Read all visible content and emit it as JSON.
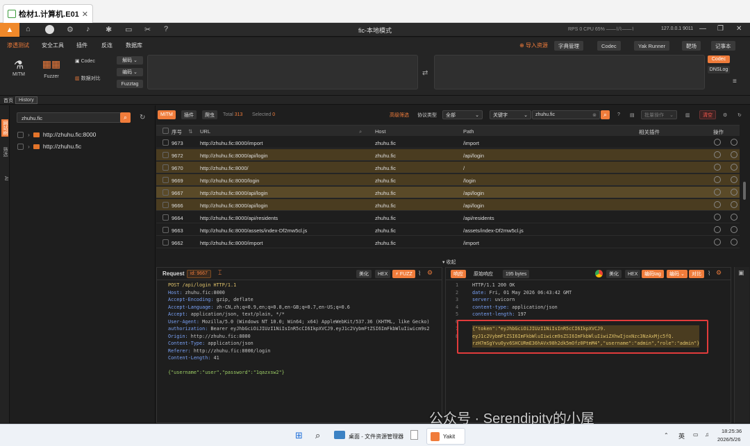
{
  "vm_tab": {
    "title": "检材1.计算机.E01",
    "close": "✕"
  },
  "app": {
    "title": "fic-本地模式",
    "stats": "RPS 0 CPU 65% ——⌇/⌇——⌇",
    "ip": "127.0.0.1  9011"
  },
  "menu": {
    "items": [
      "渗透测试",
      "安全工具",
      "插件",
      "反连",
      "数据库"
    ],
    "right": [
      "导入资源",
      "字典管理",
      "Codec",
      "Yak Runner",
      "靶场",
      "记事本"
    ]
  },
  "toolbar": {
    "mitm": "MITM",
    "fuzzer": "Fuzzer",
    "codec": "Codec",
    "compare": "数据对比",
    "decode": "解码",
    "encode": "编码",
    "fuzztag": "Fuzztag",
    "right_codec": "Codec",
    "right_dnslog": "DNSLog"
  },
  "tabs2": [
    "首页",
    "History"
  ],
  "leftvert": [
    "网站树",
    "筛选",
    "AI"
  ],
  "sidebar": {
    "search": "zhuhu.fic",
    "tree": [
      "http://zhuhu.fic:8000",
      "http://zhuhu.fic"
    ]
  },
  "filter": {
    "mitm": "MITM",
    "plugin": "插件",
    "crawler": "爬虫",
    "total_label": "Total",
    "total": "313",
    "selected_label": "Selected",
    "selected": "0",
    "advanced": "高级筛选",
    "protocol_label": "协议类型",
    "protocol": "全部",
    "keyword": "关键字",
    "keyword_value": "zhuhu.fic",
    "batch": "批量操作",
    "clear": "清空"
  },
  "table": {
    "headers": [
      "序号",
      "URL",
      "Host",
      "Path",
      "相关插件",
      "操作"
    ],
    "rows": [
      {
        "id": "9673",
        "url": "http://zhuhu.fic:8000/import",
        "host": "zhuhu.fic",
        "path": "/import",
        "color": ""
      },
      {
        "id": "9672",
        "url": "http://zhuhu.fic:8000/api/login",
        "host": "zhuhu.fic",
        "path": "/api/login",
        "color": "#4a3c20"
      },
      {
        "id": "9670",
        "url": "http://zhuhu.fic:8000/",
        "host": "zhuhu.fic",
        "path": "/",
        "color": "#4a3c20"
      },
      {
        "id": "9669",
        "url": "http://zhuhu.fic:8000/login",
        "host": "zhuhu.fic",
        "path": "/login",
        "color": "#4a3c20"
      },
      {
        "id": "9667",
        "url": "http://zhuhu.fic:8000/api/login",
        "host": "zhuhu.fic",
        "path": "/api/login",
        "color": "#5a4a28"
      },
      {
        "id": "9666",
        "url": "http://zhuhu.fic:8000/api/login",
        "host": "zhuhu.fic",
        "path": "/api/login",
        "color": "#4a3c20"
      },
      {
        "id": "9664",
        "url": "http://zhuhu.fic:8000/api/residents",
        "host": "zhuhu.fic",
        "path": "/api/residents",
        "color": ""
      },
      {
        "id": "9663",
        "url": "http://zhuhu.fic:8000/assets/index-Df2mw5cl.js",
        "host": "zhuhu.fic",
        "path": "/assets/index-Df2mw5cl.js",
        "color": ""
      },
      {
        "id": "9662",
        "url": "http://zhuhu.fic:8000/import",
        "host": "zhuhu.fic",
        "path": "/import",
        "color": ""
      }
    ]
  },
  "collapse": "收起",
  "request": {
    "title": "Request",
    "id_label": "id: 9667",
    "beautify": "美化",
    "hex": "HEX",
    "fuzz": "FUZZ",
    "lines": [
      "POST /api/login HTTP/1.1",
      "Host: zhuhu.fic:8000",
      "Accept-Encoding: gzip, deflate",
      "Accept-Language: zh-CN,zh;q=0.9,en;q=0.8,en-GB;q=0.7,en-US;q=0.6",
      "Accept: application/json, text/plain, */*",
      "User-Agent: Mozilla/5.0 (Windows NT 10.0; Win64; x64) AppleWebKit/537.36 (KHTML, like Gecko)",
      "authorization: Bearer eyJhbGciOiJIUzI1NiIsInR5cCI6IkpXVCJ9.eyJ1c2VybmFtZSI6ImFkbWluIiwicm9s2",
      "Origin: http://zhuhu.fic:8000",
      "Content-Type: application/json",
      "Referer: http://zhuhu.fic:8000/login",
      "Content-Length: 41",
      "",
      "{\"username\":\"user\",\"password\":\"1qazxsw2\"}"
    ]
  },
  "response": {
    "tab_resp": "响应",
    "tab_raw": "原始响应",
    "size": "195 bytes",
    "beautify": "美化",
    "hex": "HEX",
    "tag": "编码tag",
    "encode": "编码",
    "compare": "对比",
    "line_numbers": [
      "1",
      "2",
      "3",
      "4",
      "5",
      "6",
      "7",
      "8"
    ],
    "lines": [
      "HTTP/1.1 200 OK",
      "date: Fri, 01 May 2026 06:43:42 GMT",
      "server: uvicorn",
      "content-type: application/json",
      "content-length: 197",
      "",
      "{\"token\":\"eyJhbGciOiJIUzI1NiIsInR5cCI6IkpXVCJ9.",
      "eyJ1c2VybmFtZSI6ImFkbWluIiwicm9sZSI6ImFkbWluIiwiZXhwIjoxNzc3NzAxMjc5fQ.",
      "rzH7mSgYvu0yv6SHCURmE36hAVx98h2dk5mOfz0PtmM4\",\"username\":\"admin\",\"role\":\"admin\"}"
    ]
  },
  "taskbar": {
    "explorer": "桌面 - 文件资源管理器",
    "yakit": "Yakit",
    "ime": "英",
    "time": "18:25:36",
    "date": "2026/5/26"
  },
  "watermark": "公众号 · Serendipity的小屋",
  "colors": {
    "accent": "#f07c3b",
    "highlight_box": "#e23b3b"
  }
}
